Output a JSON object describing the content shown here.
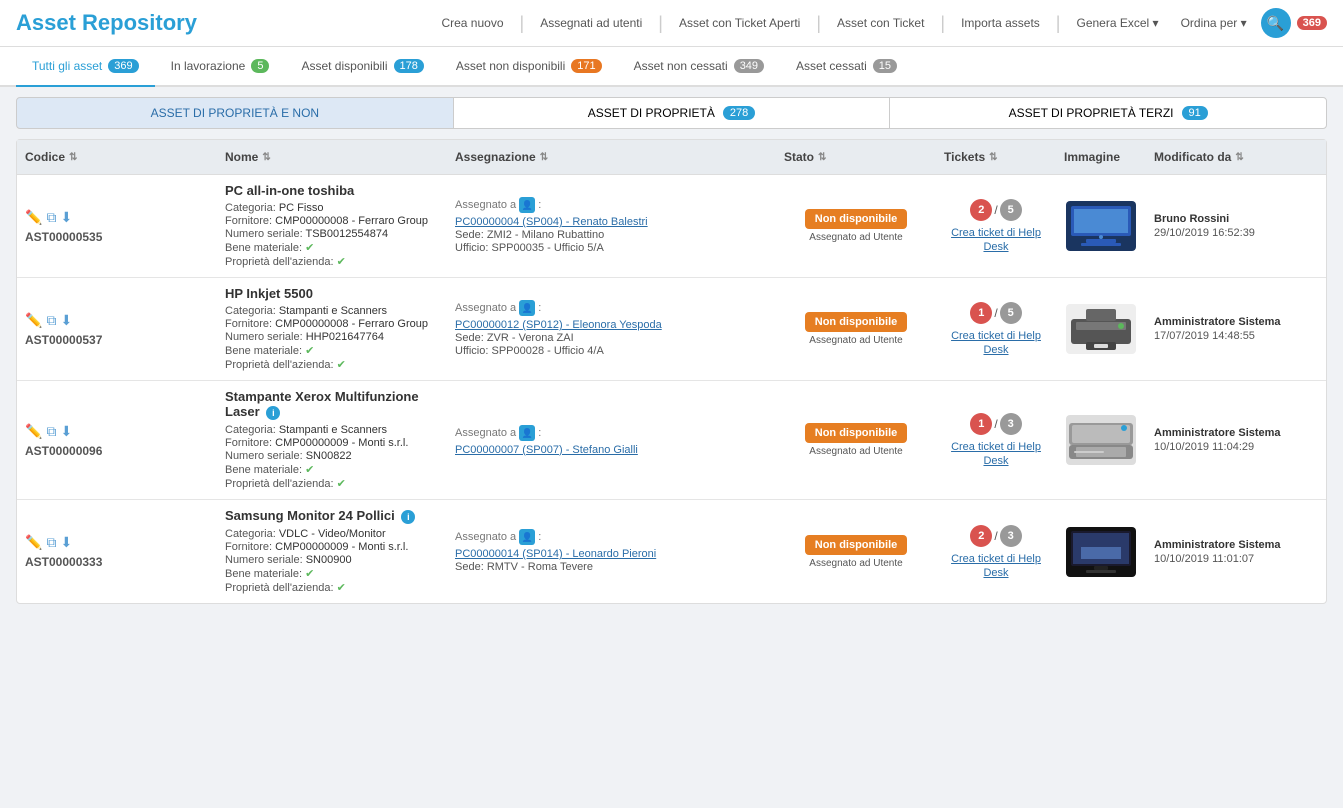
{
  "app": {
    "title": "Asset Repository",
    "search_badge": "369"
  },
  "header_buttons": [
    {
      "id": "crea-nuovo",
      "label": "Crea nuovo"
    },
    {
      "id": "assegnati-utenti",
      "label": "Assegnati ad utenti"
    },
    {
      "id": "asset-ticket-aperti",
      "label": "Asset con Ticket Aperti"
    },
    {
      "id": "asset-con-ticket",
      "label": "Asset con Ticket"
    },
    {
      "id": "importa-assets",
      "label": "Importa assets"
    },
    {
      "id": "genera-excel",
      "label": "Genera Excel",
      "dropdown": true
    },
    {
      "id": "ordina-per",
      "label": "Ordina per",
      "dropdown": true
    }
  ],
  "tabs": [
    {
      "id": "tutti",
      "label": "Tutti gli asset",
      "badge": "369",
      "active": true
    },
    {
      "id": "lavorazione",
      "label": "In lavorazione",
      "badge": "5"
    },
    {
      "id": "disponibili",
      "label": "Asset disponibili",
      "badge": "178"
    },
    {
      "id": "non-disponibili",
      "label": "Asset non disponibili",
      "badge": "171"
    },
    {
      "id": "non-cessati",
      "label": "Asset non cessati",
      "badge": "349"
    },
    {
      "id": "cessati",
      "label": "Asset cessati",
      "badge": "15"
    }
  ],
  "filters": [
    {
      "id": "proprieta-e-non",
      "label": "ASSET DI PROPRIETÀ E NON",
      "active": true
    },
    {
      "id": "proprieta",
      "label": "ASSET DI PROPRIETÀ",
      "badge": "278"
    },
    {
      "id": "proprieta-terzi",
      "label": "ASSET DI PROPRIETÀ TERZI",
      "badge": "91"
    }
  ],
  "columns": [
    {
      "id": "codice",
      "label": "Codice",
      "sortable": true
    },
    {
      "id": "nome",
      "label": "Nome",
      "sortable": true
    },
    {
      "id": "assegnazione",
      "label": "Assegnazione",
      "sortable": true
    },
    {
      "id": "stato",
      "label": "Stato",
      "sortable": true
    },
    {
      "id": "tickets",
      "label": "Tickets",
      "sortable": true
    },
    {
      "id": "immagine",
      "label": "Immagine",
      "sortable": false
    },
    {
      "id": "modificato-da",
      "label": "Modificato da",
      "sortable": true
    }
  ],
  "rows": [
    {
      "id": "row1",
      "code": "AST00000535",
      "name": "PC all-in-one toshiba",
      "categoria": "PC Fisso",
      "fornitore": "CMP00000008 - Ferraro Group",
      "numero_seriale": "TSB0012554874",
      "bene_materiale": true,
      "proprieta_azienda": true,
      "assegnato_a": "PC00000004 (SP004) - Renato Balestri",
      "sede": "ZMI2 - Milano Rubattino",
      "ufficio": "SPP00035 - Ufficio 5/A",
      "stato": "Non disponibile",
      "stato_sub": "Assegnato ad Utente",
      "ticket_open": "2",
      "ticket_total": "5",
      "ticket_open_color": "red",
      "modificato_da": "Bruno Rossini",
      "modificato_il": "29/10/2019 16:52:39",
      "img_type": "pc",
      "has_info": false
    },
    {
      "id": "row2",
      "code": "AST00000537",
      "name": "HP Inkjet 5500",
      "categoria": "Stampanti e Scanners",
      "fornitore": "CMP00000008 - Ferraro Group",
      "numero_seriale": "HHP021647764",
      "bene_materiale": true,
      "proprieta_azienda": true,
      "assegnato_a": "PC00000012 (SP012) - Eleonora Yespoda",
      "sede": "ZVR - Verona ZAI",
      "ufficio": "SPP00028 - Ufficio 4/A",
      "stato": "Non disponibile",
      "stato_sub": "Assegnato ad Utente",
      "ticket_open": "1",
      "ticket_total": "5",
      "ticket_open_color": "red",
      "modificato_da": "Amministratore Sistema",
      "modificato_il": "17/07/2019 14:48:55",
      "img_type": "printer",
      "has_info": false
    },
    {
      "id": "row3",
      "code": "AST00000096",
      "name": "Stampante Xerox Multifunzione Laser",
      "categoria": "Stampanti e Scanners",
      "fornitore": "CMP00000009 - Monti s.r.l.",
      "numero_seriale": "SN00822",
      "bene_materiale": true,
      "proprieta_azienda": true,
      "assegnato_a": "PC00000007 (SP007) - Stefano Gialli",
      "sede": "",
      "ufficio": "",
      "stato": "Non disponibile",
      "stato_sub": "Assegnato ad Utente",
      "ticket_open": "1",
      "ticket_total": "3",
      "ticket_open_color": "red",
      "modificato_da": "Amministratore Sistema",
      "modificato_il": "10/10/2019 11:04:29",
      "img_type": "scanner",
      "has_info": true
    },
    {
      "id": "row4",
      "code": "AST00000333",
      "name": "Samsung Monitor 24 Pollici",
      "categoria": "VDLC - Video/Monitor",
      "fornitore": "CMP00000009 - Monti s.r.l.",
      "numero_seriale": "SN00900",
      "bene_materiale": true,
      "proprieta_azienda": true,
      "assegnato_a": "PC00000014 (SP014) - Leonardo Pieroni",
      "sede": "RMTV - Roma Tevere",
      "ufficio": "",
      "stato": "Non disponibile",
      "stato_sub": "Assegnato ad Utente",
      "ticket_open": "2",
      "ticket_total": "3",
      "ticket_open_color": "red",
      "modificato_da": "Amministratore Sistema",
      "modificato_il": "10/10/2019 11:01:07",
      "img_type": "monitor",
      "has_info": true
    }
  ],
  "labels": {
    "categoria": "Categoria:",
    "fornitore": "Fornitore:",
    "numero_seriale": "Numero seriale:",
    "bene_materiale": "Bene materiale:",
    "proprieta_azienda": "Proprietà dell'azienda:",
    "assegnato_a_label": "Assegnato a",
    "sede_label": "Sede:",
    "ufficio_label": "Ufficio:",
    "crea_ticket": "Crea ticket di Help Desk"
  }
}
